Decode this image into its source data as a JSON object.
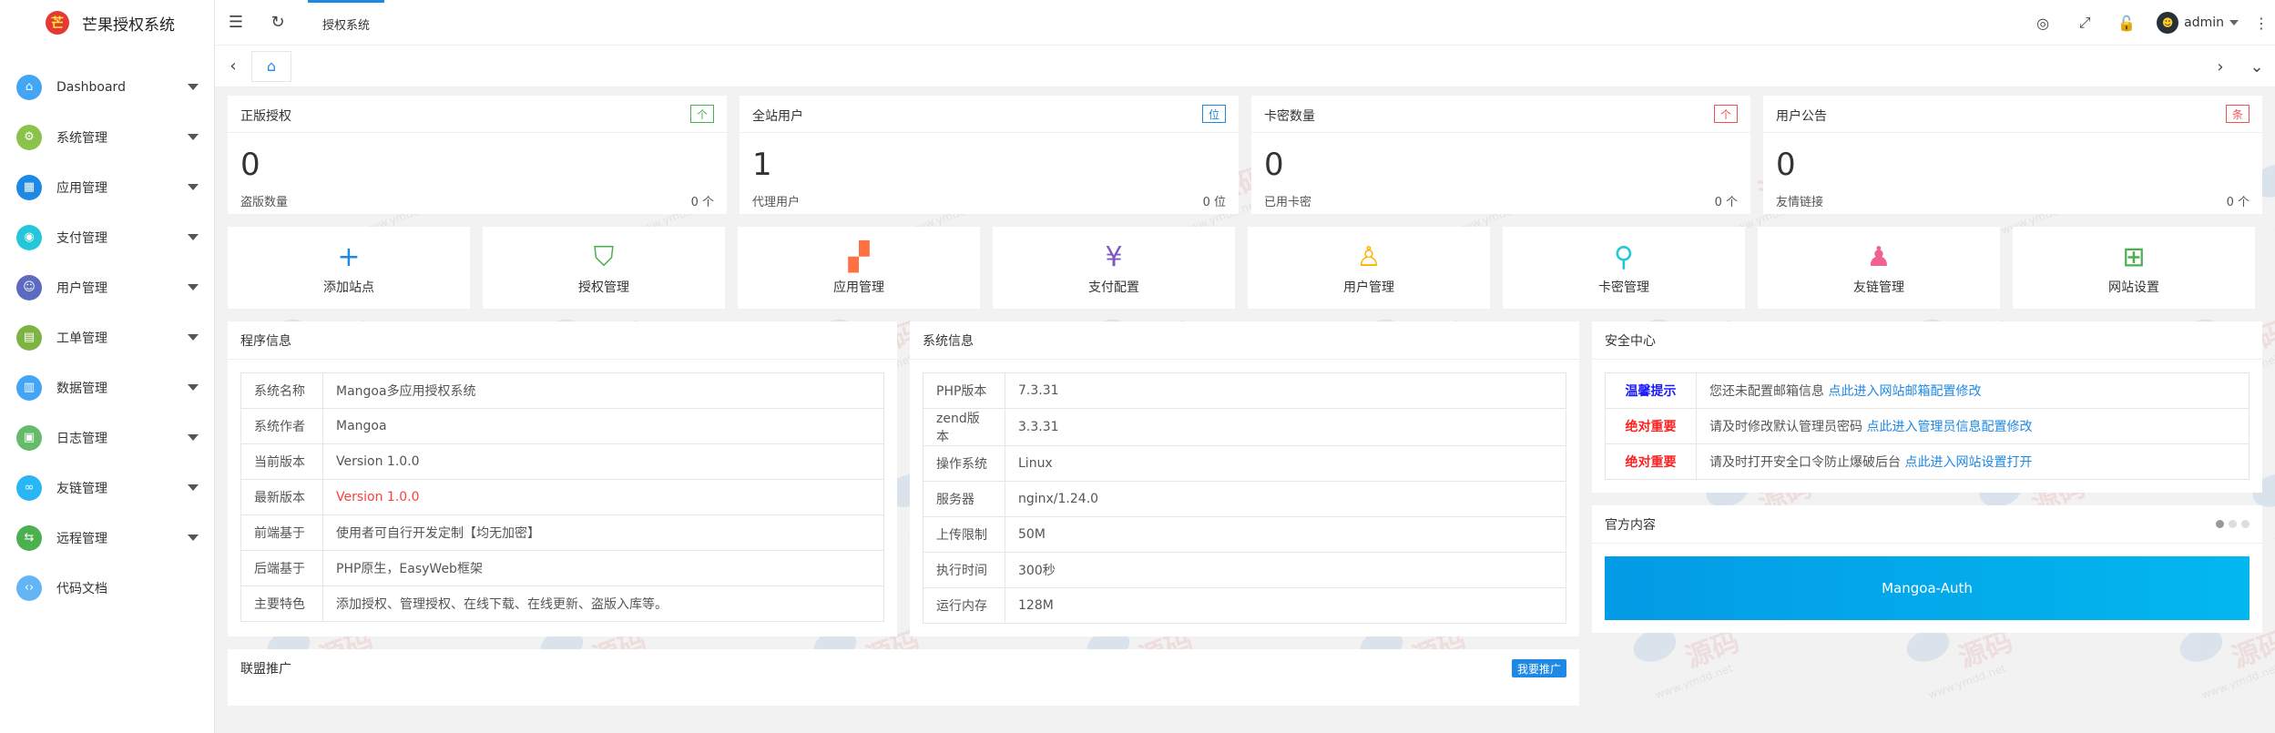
{
  "app": {
    "logo_glyph": "芒",
    "title": "芒果授权系统"
  },
  "sidebar": {
    "items": [
      {
        "label": "Dashboard",
        "color": "#42a5f5",
        "icon": "home-icon",
        "glyph": "⌂"
      },
      {
        "label": "系统管理",
        "color": "#8bc34a",
        "icon": "gear-icon",
        "glyph": "⚙"
      },
      {
        "label": "应用管理",
        "color": "#1e88e5",
        "icon": "apps-icon",
        "glyph": "▦"
      },
      {
        "label": "支付管理",
        "color": "#26c6da",
        "icon": "payment-icon",
        "glyph": "◉"
      },
      {
        "label": "用户管理",
        "color": "#5c6bc0",
        "icon": "user-icon",
        "glyph": "☺"
      },
      {
        "label": "工单管理",
        "color": "#7cb342",
        "icon": "ticket-icon",
        "glyph": "▤"
      },
      {
        "label": "数据管理",
        "color": "#42a5f5",
        "icon": "data-icon",
        "glyph": "▥"
      },
      {
        "label": "日志管理",
        "color": "#66bb6a",
        "icon": "log-icon",
        "glyph": "▣"
      },
      {
        "label": "友链管理",
        "color": "#29b6f6",
        "icon": "link-icon",
        "glyph": "∞"
      },
      {
        "label": "远程管理",
        "color": "#4caf50",
        "icon": "share-icon",
        "glyph": "⇆"
      },
      {
        "label": "代码文档",
        "color": "#64b5f6",
        "icon": "code-icon",
        "glyph": "‹›"
      }
    ]
  },
  "header": {
    "tab_label": "授权系统",
    "user_name": "admin",
    "user_avatar_glyph": "☻",
    "icons": {
      "collapse": "☰",
      "refresh": "↻",
      "theme": "◎",
      "fullscreen": "⤢",
      "lock": "🔓",
      "more": "⋮"
    }
  },
  "tabbar": {
    "prev": "‹",
    "home": "⌂",
    "next": "›",
    "dropdown": "⌄"
  },
  "stats": [
    {
      "title": "正版授权",
      "badge": "个",
      "badge_color": "#4caf50",
      "value": "0",
      "sub_label": "盗版数量",
      "sub_value": "0 个"
    },
    {
      "title": "全站用户",
      "badge": "位",
      "badge_color": "#1e88e5",
      "value": "1",
      "sub_label": "代理用户",
      "sub_value": "0 位"
    },
    {
      "title": "卡密数量",
      "badge": "个",
      "badge_color": "#ef5350",
      "value": "0",
      "sub_label": "已用卡密",
      "sub_value": "0 个"
    },
    {
      "title": "用户公告",
      "badge": "条",
      "badge_color": "#ef5350",
      "value": "0",
      "sub_label": "友情链接",
      "sub_value": "0 个"
    }
  ],
  "quick": [
    {
      "label": "添加站点",
      "glyph": "+",
      "color": "#1e88e5",
      "icon": "plus-icon"
    },
    {
      "label": "授权管理",
      "glyph": "⛉",
      "color": "#4caf50",
      "icon": "shield-check-icon"
    },
    {
      "label": "应用管理",
      "glyph": "▞",
      "color": "#ff7043",
      "icon": "apps-icon"
    },
    {
      "label": "支付配置",
      "glyph": "¥",
      "color": "#7e57c2",
      "icon": "yen-icon"
    },
    {
      "label": "用户管理",
      "glyph": "♙",
      "color": "#ffb300",
      "icon": "user-icon"
    },
    {
      "label": "卡密管理",
      "glyph": "⚲",
      "color": "#26c6da",
      "icon": "key-icon"
    },
    {
      "label": "友链管理",
      "glyph": "♟",
      "color": "#f06292",
      "icon": "users-icon"
    },
    {
      "label": "网站设置",
      "glyph": "⊞",
      "color": "#4caf50",
      "icon": "windows-icon"
    }
  ],
  "program_info": {
    "title": "程序信息",
    "rows": [
      {
        "k": "系统名称",
        "v": "Mangoa多应用授权系统"
      },
      {
        "k": "系统作者",
        "v": "Mangoa"
      },
      {
        "k": "当前版本",
        "v": "Version 1.0.0"
      },
      {
        "k": "最新版本",
        "v": "Version 1.0.0"
      },
      {
        "k": "前端基于",
        "v": "使用者可自行开发定制【均无加密】"
      },
      {
        "k": "后端基于",
        "v": "PHP原生，EasyWeb框架"
      },
      {
        "k": "主要特色",
        "v": "添加授权、管理授权、在线下载、在线更新、盗版入库等。"
      }
    ]
  },
  "system_info": {
    "title": "系统信息",
    "rows": [
      {
        "k": "PHP版本",
        "v": "7.3.31"
      },
      {
        "k": "zend版本",
        "v": "3.3.31"
      },
      {
        "k": "操作系统",
        "v": "Linux"
      },
      {
        "k": "服务器",
        "v": "nginx/1.24.0"
      },
      {
        "k": "上传限制",
        "v": "50M"
      },
      {
        "k": "执行时间",
        "v": "300秒"
      },
      {
        "k": "运行内存",
        "v": "128M"
      }
    ]
  },
  "security": {
    "title": "安全中心",
    "rows": [
      {
        "level": "温馨提示",
        "text": "您还未配置邮箱信息 ",
        "link": "点此进入网站邮箱配置修改"
      },
      {
        "level": "绝对重要",
        "text": "请及时修改默认管理员密码 ",
        "link": "点此进入管理员信息配置修改"
      },
      {
        "level": "绝对重要",
        "text": "请及时打开安全口令防止爆破后台 ",
        "link": "点此进入网站设置打开"
      }
    ]
  },
  "official": {
    "title": "官方内容",
    "banner": "Mangoa-Auth"
  },
  "alliance": {
    "title": "联盟推广",
    "button": "我要推广"
  },
  "watermark": {
    "text": "源码",
    "url": "www.ymdd.net"
  }
}
